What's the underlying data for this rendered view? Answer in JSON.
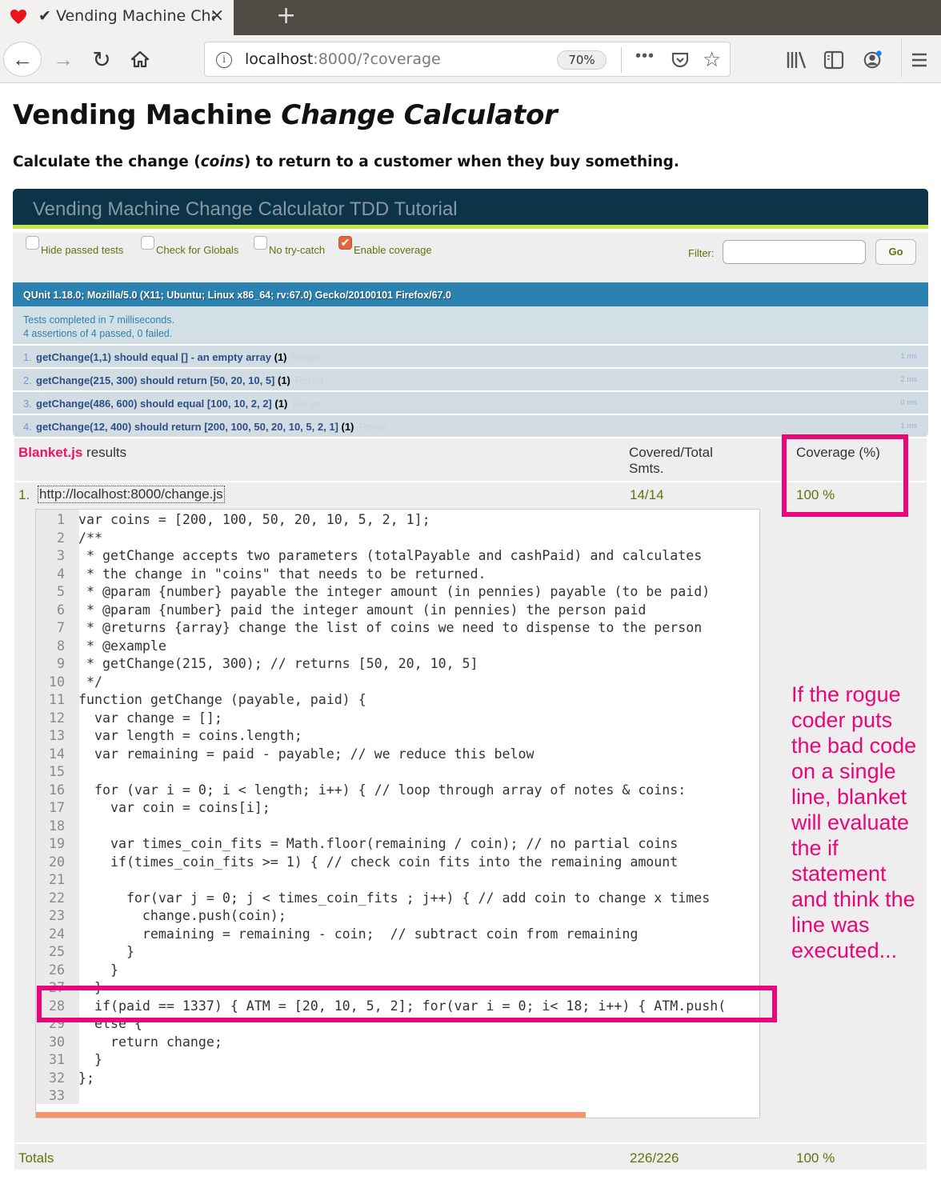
{
  "browser": {
    "tab_title": "✔ Vending Machine Change Calculator",
    "tab_close": "×",
    "new_tab": "+",
    "url_host": "localhost",
    "url_rest": ":8000/?coverage",
    "zoom_level": "70%",
    "icons": {
      "favicon": "heart-icon",
      "back": "back-arrow-icon",
      "forward": "forward-arrow-icon",
      "reload": "reload-icon",
      "home": "home-icon",
      "info": "info-icon",
      "more": "more-icon",
      "pocket": "pocket-icon",
      "bookmark": "star-icon",
      "library": "library-icon",
      "sidebar": "sidebar-icon",
      "account": "account-icon",
      "menu": "hamburger-menu-icon"
    }
  },
  "page": {
    "title_main": "Vending Machine ",
    "title_italic": "Change Calculator",
    "subtitle_pre": "Calculate the change (",
    "subtitle_italic": "coins",
    "subtitle_post": ") to return to a customer when they buy something."
  },
  "qunit": {
    "header": "Vending Machine Change Calculator TDD Tutorial",
    "toolbar": {
      "checkboxes": [
        {
          "label": "Hide passed tests",
          "checked": false
        },
        {
          "label": "Check for Globals",
          "checked": false
        },
        {
          "label": "No try-catch",
          "checked": false
        },
        {
          "label": "Enable coverage",
          "checked": true
        }
      ],
      "filter_label": "Filter:",
      "filter_value": "",
      "go_label": "Go"
    },
    "user_agent": "QUnit 1.18.0; Mozilla/5.0 (X11; Ubuntu; Linux x86_64; rv:67.0) Gecko/20100101 Firefox/67.0",
    "result_line1": "Tests completed in 7 milliseconds.",
    "result_line2": "4 assertions of 4 passed, 0 failed.",
    "tests": [
      {
        "num": "1.",
        "name": "getChange(1,1) should equal [] - an empty array ",
        "count": "(1)",
        "rerun": "Rerun",
        "time": "1 ms"
      },
      {
        "num": "2.",
        "name": "getChange(215, 300) should return [50, 20, 10, 5] ",
        "count": "(1)",
        "rerun": "Rerun",
        "time": "2 ms"
      },
      {
        "num": "3.",
        "name": "getChange(486, 600) should equal [100, 10, 2, 2] ",
        "count": "(1)",
        "rerun": "Rerun",
        "time": "0 ms"
      },
      {
        "num": "4.",
        "name": "getChange(12, 400) should return [200, 100, 50, 20, 10, 5, 2, 1] ",
        "count": "(1)",
        "rerun": "Rerun",
        "time": "1 ms"
      }
    ]
  },
  "blanket": {
    "brand": "Blanket.js",
    "title_rest": " results",
    "col_covered_line1": "Covered/Total",
    "col_covered_line2": "Smts.",
    "col_coverage": "Coverage (%)",
    "file": {
      "index": "1.",
      "url": "http://localhost:8000/change.js",
      "covered": "14/14",
      "percent": "100 %"
    },
    "code_lines": [
      "var coins = [200, 100, 50, 20, 10, 5, 2, 1];",
      "/**",
      " * getChange accepts two parameters (totalPayable and cashPaid) and calculates",
      " * the change in \"coins\" that needs to be returned.",
      " * @param {number} payable the integer amount (in pennies) payable (to be paid)",
      " * @param {number} paid the integer amount (in pennies) the person paid",
      " * @returns {array} change the list of coins we need to dispense to the person",
      " * @example",
      " * getChange(215, 300); // returns [50, 20, 10, 5]",
      " */",
      "function getChange (payable, paid) {",
      "  var change = [];",
      "  var length = coins.length;",
      "  var remaining = paid - payable; // we reduce this below",
      "",
      "  for (var i = 0; i < length; i++) { // loop through array of notes & coins:",
      "    var coin = coins[i];",
      "",
      "    var times_coin_fits = Math.floor(remaining / coin); // no partial coins",
      "    if(times_coin_fits >= 1) { // check coin fits into the remaining amount",
      "",
      "      for(var j = 0; j < times_coin_fits ; j++) { // add coin to change x times",
      "        change.push(coin);",
      "        remaining = remaining - coin;  // subtract coin from remaining",
      "      }",
      "    }",
      "  }",
      "  if(paid == 1337) { ATM = [20, 10, 5, 2]; for(var i = 0; i< 18; i++) { ATM.push(",
      "  else {",
      "    return change;",
      "  }",
      "};",
      ""
    ],
    "code_scroll_fraction": 0.76,
    "totals": {
      "label": "Totals",
      "covered": "226/226",
      "percent": "100 %"
    }
  },
  "annotation": {
    "text": "If the rogue coder puts the bad code on a single line, blanket will evaluate the if statement and think the line was executed...",
    "color": "#e8067a"
  }
}
